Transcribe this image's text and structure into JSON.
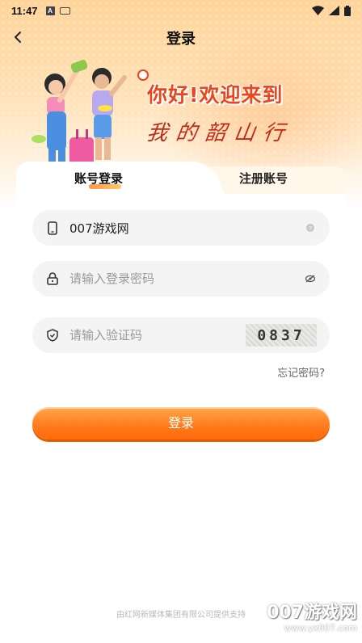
{
  "status_bar": {
    "time": "11:47",
    "icons": [
      "a-notification-icon",
      "keyboard-icon",
      "wifi-icon",
      "signal-icon",
      "battery-icon"
    ]
  },
  "header": {
    "title": "登录",
    "back_icon": "chevron-left-icon"
  },
  "banner": {
    "welcome": "你好!欢迎来到",
    "slogan": "我的韶山行"
  },
  "tabs": [
    {
      "label": "账号登录",
      "active": true
    },
    {
      "label": "注册账号",
      "active": false
    }
  ],
  "form": {
    "account": {
      "value": "007游戏网",
      "icon": "phone-icon",
      "tail_icon": "help-icon"
    },
    "password": {
      "placeholder": "请输入登录密码",
      "icon": "lock-icon",
      "tail_icon": "eye-off-icon"
    },
    "captcha": {
      "placeholder": "请输入验证码",
      "icon": "shield-icon",
      "code": "0837"
    }
  },
  "forgot_label": "忘记密码?",
  "login_label": "登录",
  "footer": "由红网新媒体集团有限公司提供支持",
  "watermark": {
    "main": "007游戏网",
    "sub": "www.yx007.com"
  },
  "colors": {
    "accent": "#ff7a1c",
    "title_red": "#e8461c",
    "field_bg": "#f4f4f4"
  }
}
